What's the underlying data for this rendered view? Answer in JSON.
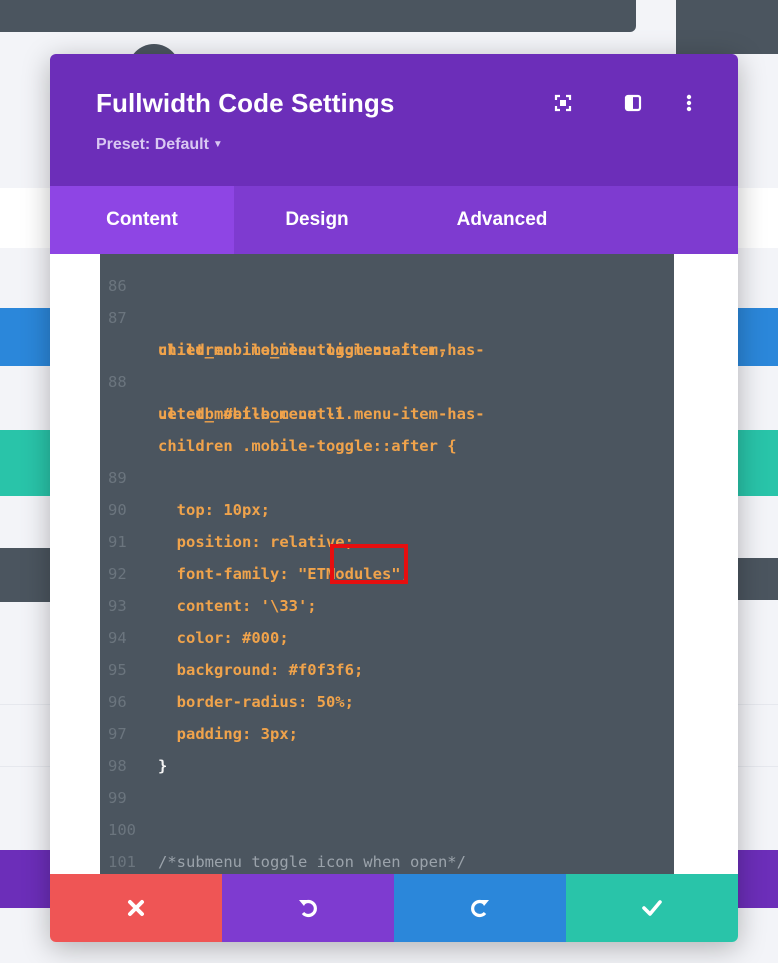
{
  "modal": {
    "title": "Fullwidth Code Settings",
    "preset_label": "Preset: Default",
    "header_icons": [
      "focus-mode-icon",
      "split-view-icon",
      "more-options-icon"
    ],
    "tabs": [
      {
        "label": "Content",
        "active": true
      },
      {
        "label": "Design",
        "active": false
      },
      {
        "label": "Advanced",
        "active": false
      }
    ],
    "footer_buttons": [
      "discard-icon",
      "undo-icon",
      "redo-icon",
      "save-icon"
    ]
  },
  "editor": {
    "partial_top_line": "86",
    "lines": [
      {
        "n": "87",
        "text": "ul.et_mobile_menu li.menu-item-has-"
      },
      {
        "n": "",
        "text": "children .mobile-toggle::after,"
      },
      {
        "n": "88",
        "text": ".et-db #et-boc .et-l"
      },
      {
        "n": "",
        "text": "ul.et_mobile_menu li.menu-item-has-"
      },
      {
        "n": "",
        "text": "children .mobile-toggle::after {"
      },
      {
        "n": "89",
        "text": "  top: 10px;"
      },
      {
        "n": "90",
        "text": "  position: relative;"
      },
      {
        "n": "91",
        "text": "  font-family: \"ETModules\";"
      },
      {
        "n": "92",
        "text": "  content: '\\33';"
      },
      {
        "n": "93",
        "text": "  color: #000;"
      },
      {
        "n": "94",
        "text": "  background: #f0f3f6;"
      },
      {
        "n": "95",
        "text": "  border-radius: 50%;"
      },
      {
        "n": "96",
        "text": "  padding: 3px;"
      },
      {
        "n": "97",
        "text": "}"
      },
      {
        "n": "98",
        "text": ""
      },
      {
        "n": "99",
        "text": ""
      },
      {
        "n": "100",
        "text": "/*submenu toggle icon when open*/"
      },
      {
        "n": "101",
        "text": ""
      }
    ]
  },
  "colors": {
    "header": "#6c2eb9",
    "tabs": "#7e3bd0",
    "active_tab": "#8e45e4",
    "editor_bg": "#4b555f",
    "discard": "#ef5555",
    "undo": "#7e3bd0",
    "redo": "#2b87da",
    "save": "#29c4a9"
  }
}
